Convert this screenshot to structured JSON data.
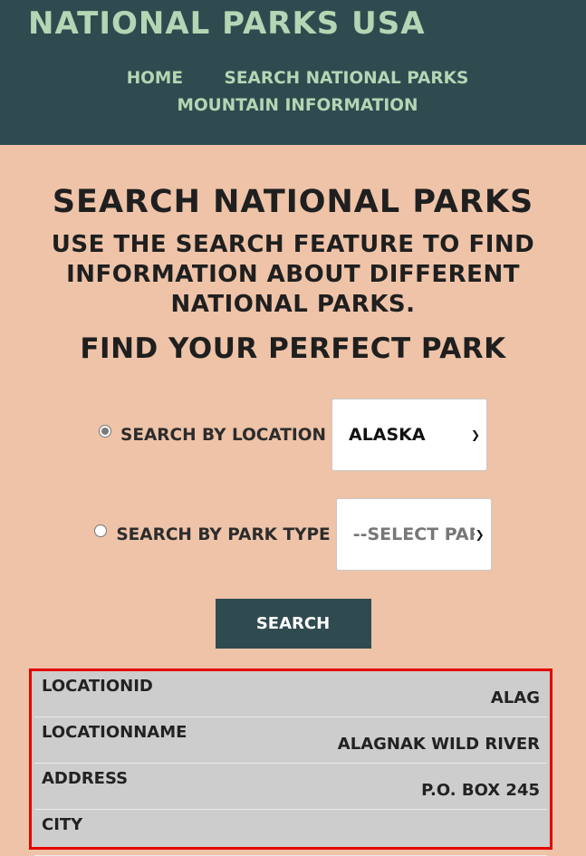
{
  "header": {
    "title": "National Parks USA",
    "nav": [
      {
        "label": "Home"
      },
      {
        "label": "Search National Parks"
      },
      {
        "label": "Mountain Information"
      }
    ]
  },
  "main": {
    "heading": "Search National Parks",
    "subheading": "Use the search feature to find information about different national parks.",
    "find_heading": "Find Your Perfect Park"
  },
  "search_form": {
    "location_option": {
      "label": "Search by Location",
      "selected": true,
      "value": "Alaska"
    },
    "park_type_option": {
      "label": "Search by Park Type",
      "selected": false,
      "value": "--Select Park Type--"
    },
    "search_button": "Search"
  },
  "results": [
    {
      "key": "LocationID",
      "value": "ALAG"
    },
    {
      "key": "LocationName",
      "value": "Alagnak Wild River"
    },
    {
      "key": "Address",
      "value": "P.O. Box 245"
    },
    {
      "key": "City",
      "value": ""
    }
  ],
  "colors": {
    "header_bg": "#2f4b4f",
    "header_text": "#b6d5b4",
    "page_bg": "#eec3a8",
    "results_border": "#e40000",
    "results_bg": "#cdcdcd"
  }
}
